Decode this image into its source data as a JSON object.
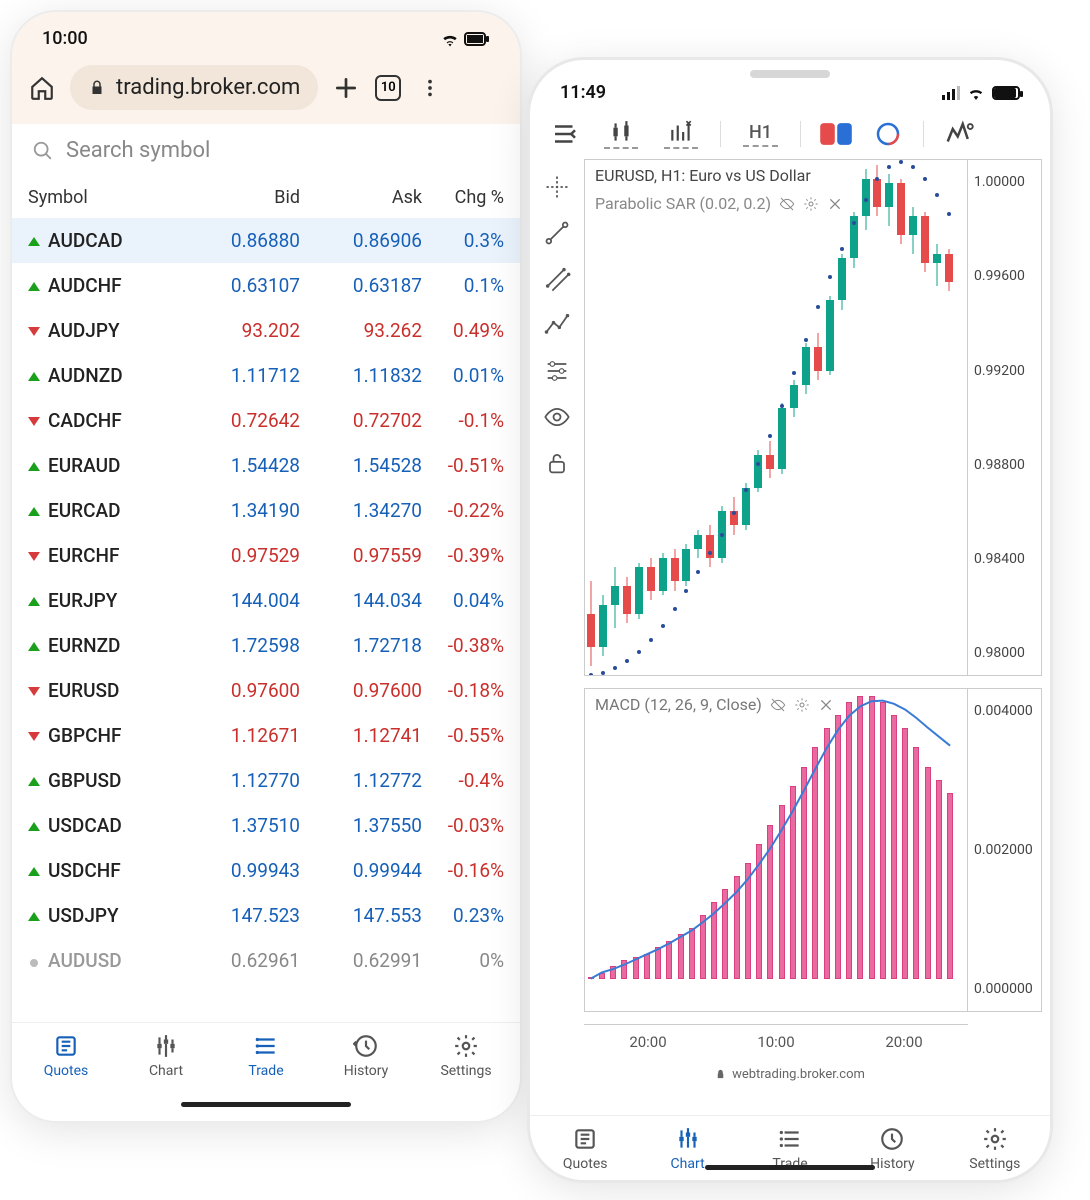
{
  "android": {
    "status_time": "10:00",
    "browser_url": "trading.broker.com",
    "tab_count": "10",
    "search_placeholder": "Search symbol",
    "columns": {
      "symbol": "Symbol",
      "bid": "Bid",
      "ask": "Ask",
      "chg": "Chg %"
    },
    "rows": [
      {
        "sym": "AUDCAD",
        "dir": "up",
        "bid": "0.86880",
        "ask": "0.86906",
        "chg": "0.3%",
        "tone": "blue",
        "sel": true
      },
      {
        "sym": "AUDCHF",
        "dir": "up",
        "bid": "0.63107",
        "ask": "0.63187",
        "chg": "0.1%",
        "tone": "blue"
      },
      {
        "sym": "AUDJPY",
        "dir": "down",
        "bid": "93.202",
        "ask": "93.262",
        "chg": "0.49%",
        "tone": "red"
      },
      {
        "sym": "AUDNZD",
        "dir": "up",
        "bid": "1.11712",
        "ask": "1.11832",
        "chg": "0.01%",
        "tone": "blue"
      },
      {
        "sym": "CADCHF",
        "dir": "down",
        "bid": "0.72642",
        "ask": "0.72702",
        "chg": "-0.1%",
        "tone": "red"
      },
      {
        "sym": "EURAUD",
        "dir": "up",
        "bid": "1.54428",
        "ask": "1.54528",
        "chg": "-0.51%",
        "tone": "blue",
        "chgtone": "red"
      },
      {
        "sym": "EURCAD",
        "dir": "up",
        "bid": "1.34190",
        "ask": "1.34270",
        "chg": "-0.22%",
        "tone": "blue",
        "chgtone": "red"
      },
      {
        "sym": "EURCHF",
        "dir": "down",
        "bid": "0.97529",
        "ask": "0.97559",
        "chg": "-0.39%",
        "tone": "red"
      },
      {
        "sym": "EURJPY",
        "dir": "up",
        "bid": "144.004",
        "ask": "144.034",
        "chg": "0.04%",
        "tone": "blue"
      },
      {
        "sym": "EURNZD",
        "dir": "up",
        "bid": "1.72598",
        "ask": "1.72718",
        "chg": "-0.38%",
        "tone": "blue",
        "chgtone": "red"
      },
      {
        "sym": "EURUSD",
        "dir": "down",
        "bid": "0.97600",
        "ask": "0.97600",
        "chg": "-0.18%",
        "tone": "red"
      },
      {
        "sym": "GBPCHF",
        "dir": "down",
        "bid": "1.12671",
        "ask": "1.12741",
        "chg": "-0.55%",
        "tone": "red"
      },
      {
        "sym": "GBPUSD",
        "dir": "up",
        "bid": "1.12770",
        "ask": "1.12772",
        "chg": "-0.4%",
        "tone": "blue",
        "chgtone": "red"
      },
      {
        "sym": "USDCAD",
        "dir": "up",
        "bid": "1.37510",
        "ask": "1.37550",
        "chg": "-0.03%",
        "tone": "blue",
        "chgtone": "red"
      },
      {
        "sym": "USDCHF",
        "dir": "up",
        "bid": "0.99943",
        "ask": "0.99944",
        "chg": "-0.16%",
        "tone": "blue",
        "chgtone": "red"
      },
      {
        "sym": "USDJPY",
        "dir": "up",
        "bid": "147.523",
        "ask": "147.553",
        "chg": "0.23%",
        "tone": "blue"
      },
      {
        "sym": "AUDUSD",
        "dir": "dot",
        "bid": "0.62961",
        "ask": "0.62991",
        "chg": "0%",
        "tone": "grey"
      }
    ],
    "nav": {
      "quotes": "Quotes",
      "chart": "Chart",
      "trade": "Trade",
      "history": "History",
      "settings": "Settings"
    }
  },
  "ios": {
    "status_time": "11:49",
    "toolbar_timeframe": "H1",
    "chart_title": "EURUSD, H1: Euro vs US Dollar",
    "indicator_label": "Parabolic SAR (0.02, 0.2)",
    "macd_label": "MACD (12, 26, 9, Close)",
    "yaxis_main": [
      "1.00000",
      "0.99600",
      "0.99200",
      "0.98800",
      "0.98400",
      "0.98000"
    ],
    "yaxis_macd": [
      "0.004000",
      "0.002000",
      "0.000000"
    ],
    "xaxis_labels": [
      "20:00",
      "10:00",
      "20:00"
    ],
    "nav": {
      "quotes": "Quotes",
      "chart": "Chart",
      "trade": "Trade",
      "history": "History",
      "settings": "Settings"
    },
    "url": "webtrading.broker.com"
  },
  "chart_data": {
    "main": {
      "type": "candlestick",
      "title": "EURUSD, H1: Euro vs US Dollar",
      "ylim": [
        0.978,
        1.0
      ],
      "ylabel_ticks": [
        1.0,
        0.996,
        0.992,
        0.988,
        0.984,
        0.98
      ],
      "indicator": {
        "name": "Parabolic SAR",
        "params": [
          0.02,
          0.2
        ]
      },
      "candles": [
        {
          "o": 0.9806,
          "h": 0.982,
          "l": 0.9784,
          "c": 0.9792,
          "dir": "down"
        },
        {
          "o": 0.9792,
          "h": 0.9814,
          "l": 0.9788,
          "c": 0.981,
          "dir": "up"
        },
        {
          "o": 0.981,
          "h": 0.9826,
          "l": 0.98,
          "c": 0.9818,
          "dir": "up"
        },
        {
          "o": 0.9818,
          "h": 0.9822,
          "l": 0.9802,
          "c": 0.9806,
          "dir": "down"
        },
        {
          "o": 0.9806,
          "h": 0.9828,
          "l": 0.9804,
          "c": 0.9826,
          "dir": "up"
        },
        {
          "o": 0.9826,
          "h": 0.983,
          "l": 0.9812,
          "c": 0.9816,
          "dir": "down"
        },
        {
          "o": 0.9816,
          "h": 0.9832,
          "l": 0.9814,
          "c": 0.983,
          "dir": "up"
        },
        {
          "o": 0.983,
          "h": 0.9834,
          "l": 0.9816,
          "c": 0.982,
          "dir": "down"
        },
        {
          "o": 0.982,
          "h": 0.9836,
          "l": 0.9818,
          "c": 0.9834,
          "dir": "up"
        },
        {
          "o": 0.9834,
          "h": 0.9842,
          "l": 0.983,
          "c": 0.984,
          "dir": "up"
        },
        {
          "o": 0.984,
          "h": 0.9844,
          "l": 0.9826,
          "c": 0.983,
          "dir": "down"
        },
        {
          "o": 0.983,
          "h": 0.9852,
          "l": 0.9828,
          "c": 0.985,
          "dir": "up"
        },
        {
          "o": 0.985,
          "h": 0.9856,
          "l": 0.984,
          "c": 0.9844,
          "dir": "down"
        },
        {
          "o": 0.9844,
          "h": 0.9862,
          "l": 0.9842,
          "c": 0.986,
          "dir": "up"
        },
        {
          "o": 0.986,
          "h": 0.9876,
          "l": 0.9858,
          "c": 0.9874,
          "dir": "up"
        },
        {
          "o": 0.9874,
          "h": 0.988,
          "l": 0.9864,
          "c": 0.9868,
          "dir": "down"
        },
        {
          "o": 0.9868,
          "h": 0.9896,
          "l": 0.9866,
          "c": 0.9894,
          "dir": "up"
        },
        {
          "o": 0.9894,
          "h": 0.9906,
          "l": 0.989,
          "c": 0.9904,
          "dir": "up"
        },
        {
          "o": 0.9904,
          "h": 0.9922,
          "l": 0.99,
          "c": 0.992,
          "dir": "up"
        },
        {
          "o": 0.992,
          "h": 0.9926,
          "l": 0.9906,
          "c": 0.991,
          "dir": "down"
        },
        {
          "o": 0.991,
          "h": 0.9942,
          "l": 0.9908,
          "c": 0.994,
          "dir": "up"
        },
        {
          "o": 0.994,
          "h": 0.996,
          "l": 0.9936,
          "c": 0.9958,
          "dir": "up"
        },
        {
          "o": 0.9958,
          "h": 0.9978,
          "l": 0.9954,
          "c": 0.9976,
          "dir": "up"
        },
        {
          "o": 0.9976,
          "h": 0.9996,
          "l": 0.997,
          "c": 0.9992,
          "dir": "up"
        },
        {
          "o": 0.9992,
          "h": 0.9998,
          "l": 0.9976,
          "c": 0.998,
          "dir": "down"
        },
        {
          "o": 0.998,
          "h": 0.9994,
          "l": 0.9972,
          "c": 0.999,
          "dir": "up"
        },
        {
          "o": 0.999,
          "h": 0.9992,
          "l": 0.9964,
          "c": 0.9968,
          "dir": "down"
        },
        {
          "o": 0.9968,
          "h": 0.998,
          "l": 0.996,
          "c": 0.9976,
          "dir": "up"
        },
        {
          "o": 0.9976,
          "h": 0.9978,
          "l": 0.9952,
          "c": 0.9956,
          "dir": "down"
        },
        {
          "o": 0.9956,
          "h": 0.9964,
          "l": 0.9946,
          "c": 0.996,
          "dir": "up"
        },
        {
          "o": 0.996,
          "h": 0.9962,
          "l": 0.9944,
          "c": 0.9948,
          "dir": "down"
        }
      ],
      "sar": [
        0.978,
        0.9781,
        0.9783,
        0.9786,
        0.979,
        0.9795,
        0.9801,
        0.9808,
        0.9816,
        0.9824,
        0.9832,
        0.984,
        0.9849,
        0.9859,
        0.987,
        0.9882,
        0.9895,
        0.9909,
        0.9923,
        0.9937,
        0.995,
        0.9962,
        0.9973,
        0.9983,
        0.9992,
        0.9997,
        0.9999,
        0.9997,
        0.9992,
        0.9985,
        0.9977
      ]
    },
    "macd": {
      "type": "bar+line",
      "title": "MACD (12, 26, 9, Close)",
      "ylim": [
        -0.0005,
        0.0045
      ],
      "ylabel_ticks": [
        0.004,
        0.002,
        0.0
      ],
      "histogram": [
        0.0,
        0.0001,
        0.0002,
        0.0003,
        0.00035,
        0.0004,
        0.0005,
        0.0006,
        0.0007,
        0.0008,
        0.001,
        0.0012,
        0.0014,
        0.0016,
        0.0018,
        0.0021,
        0.0024,
        0.0027,
        0.003,
        0.0033,
        0.0036,
        0.0039,
        0.0041,
        0.0043,
        0.0044,
        0.0044,
        0.0043,
        0.0041,
        0.0039,
        0.0036,
        0.0033,
        0.0031,
        0.0029
      ],
      "signal": [
        0.0,
        0.0001,
        0.00015,
        0.00022,
        0.0003,
        0.00038,
        0.00046,
        0.00055,
        0.00065,
        0.00075,
        0.00088,
        0.00102,
        0.00118,
        0.00135,
        0.00155,
        0.00178,
        0.00203,
        0.00231,
        0.00261,
        0.00293,
        0.00326,
        0.00358,
        0.00386,
        0.00408,
        0.00423,
        0.00431,
        0.00432,
        0.00427,
        0.00418,
        0.00405,
        0.0039,
        0.00376,
        0.00362
      ]
    },
    "x_ticks": [
      "20:00",
      "10:00",
      "20:00"
    ]
  }
}
